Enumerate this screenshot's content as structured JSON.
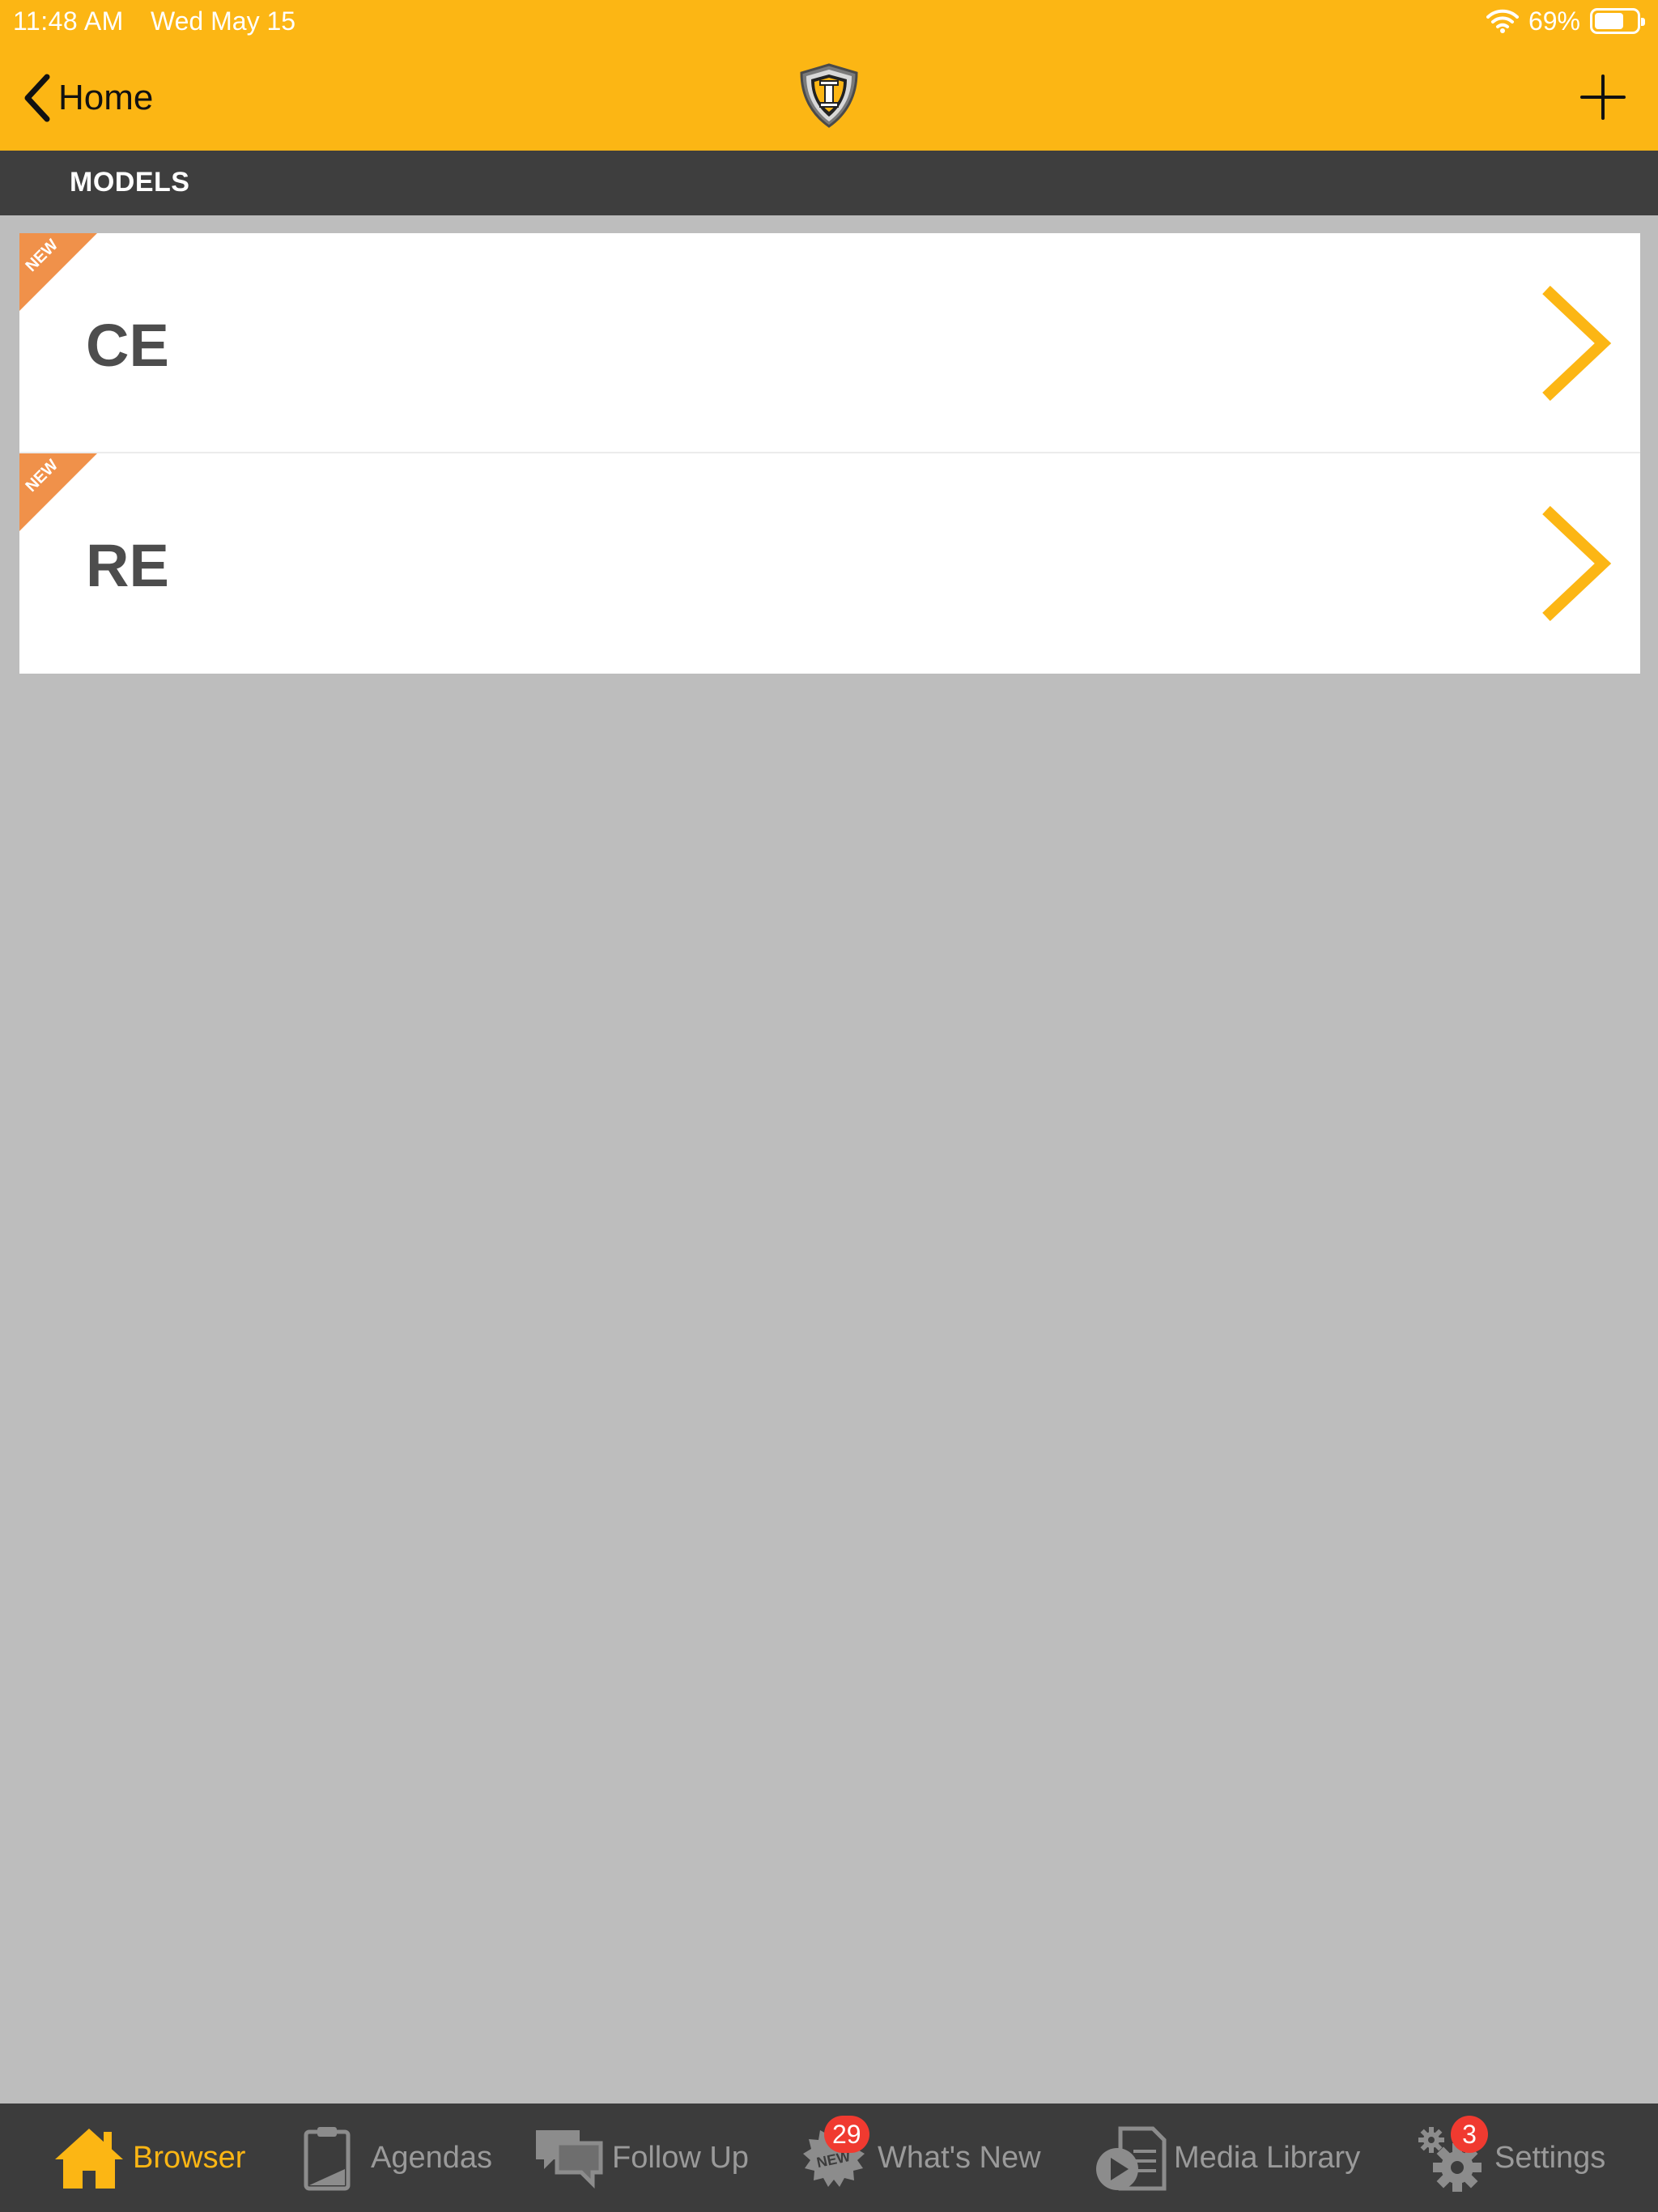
{
  "status_bar": {
    "time": "11:48 AM",
    "date": "Wed May 15",
    "battery_percent": "69%",
    "battery_level": 0.69
  },
  "nav": {
    "back_label": "Home",
    "back_icon": "chevron-left-icon",
    "logo_icon": "shield-logo-icon",
    "add_icon": "plus-icon"
  },
  "section": {
    "title": "MODELS"
  },
  "list": {
    "items": [
      {
        "label": "CE",
        "ribbon": "NEW"
      },
      {
        "label": "RE",
        "ribbon": "NEW"
      }
    ]
  },
  "tabbar": {
    "tabs": [
      {
        "label": "Browser",
        "icon": "home-icon",
        "active": true
      },
      {
        "label": "Agendas",
        "icon": "clipboard-icon"
      },
      {
        "label": "Follow Up",
        "icon": "chat-bubbles-icon"
      },
      {
        "label": "What's New",
        "icon": "new-seal-icon",
        "badge": "29"
      },
      {
        "label": "Media Library",
        "icon": "media-file-icon"
      },
      {
        "label": "Settings",
        "icon": "gears-icon",
        "badge": "3"
      }
    ]
  },
  "colors": {
    "accent": "#fcb614",
    "header_dark": "#3e3e3e",
    "background": "#bdbdbd",
    "ribbon": "#f0914a",
    "badge": "#f03a30",
    "tab_inactive": "#9a9a9a"
  }
}
